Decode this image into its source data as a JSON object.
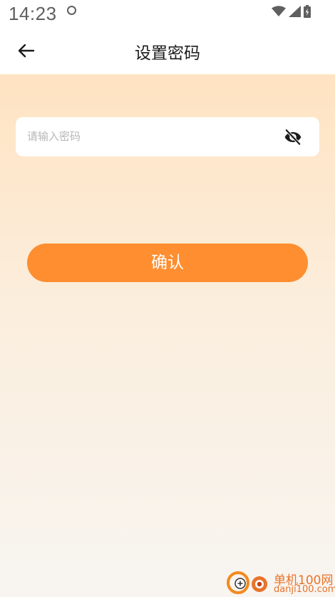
{
  "status_bar": {
    "time": "14:23",
    "icons": [
      "circle-icon",
      "wifi-icon",
      "signal-icon",
      "battery-icon"
    ]
  },
  "header": {
    "title": "设置密码",
    "back_icon": "arrow-left-icon"
  },
  "form": {
    "password_placeholder": "请输入密码",
    "password_value": "",
    "visibility_icon": "eye-off-icon",
    "confirm_label": "确认"
  },
  "watermark": {
    "name": "单机100网",
    "domain": "danji100.com"
  },
  "colors": {
    "accent": "#fe8e2f",
    "gradient_top": "#ffe3c2",
    "gradient_bottom": "#f8f5f1",
    "watermark": "#e8732a"
  }
}
